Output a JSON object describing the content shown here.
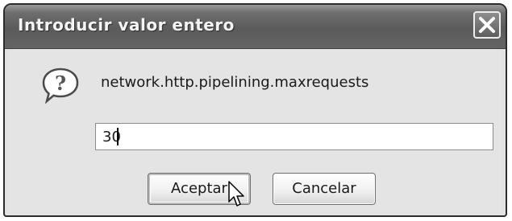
{
  "dialog": {
    "title": "Introducir valor entero",
    "close_icon": "close-icon",
    "prompt_icon": "question-icon",
    "prompt": "network.http.pipelining.maxrequests",
    "input": {
      "value": "30"
    },
    "buttons": {
      "accept": "Aceptar",
      "cancel": "Cancelar"
    }
  },
  "colors": {
    "titlebar": "#5b5b5b",
    "title_text": "#f4f4f4",
    "dialog_bg": "#e4e4e4"
  }
}
